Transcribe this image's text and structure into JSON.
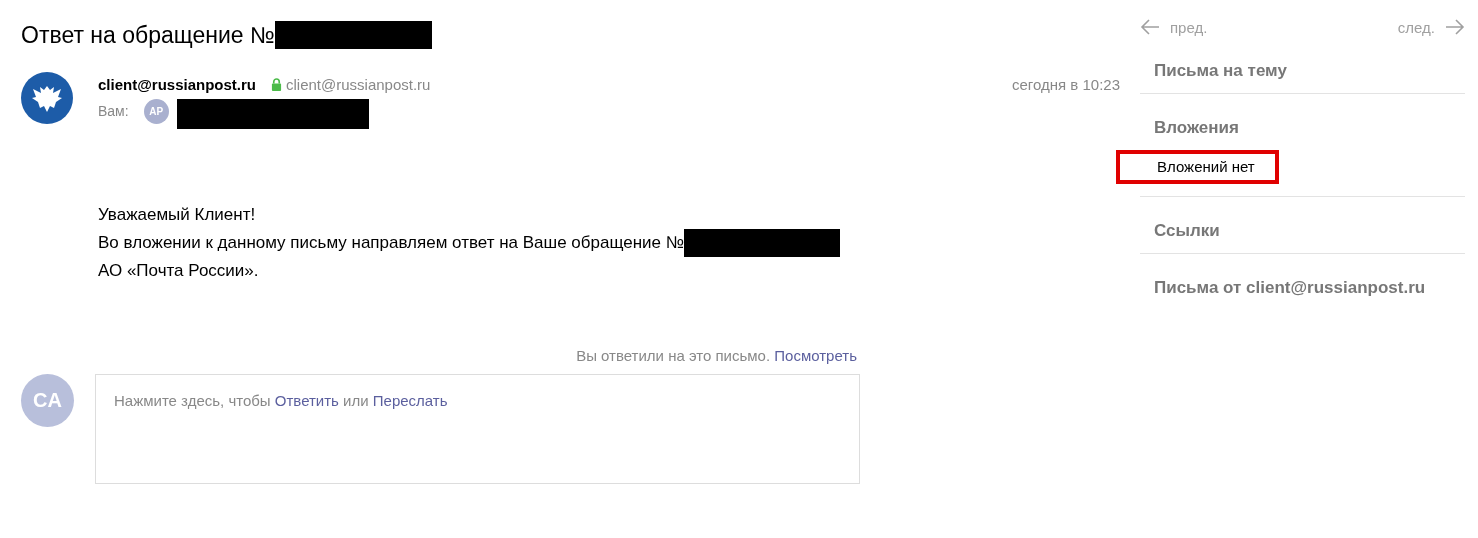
{
  "subject": "Ответ на обращение №",
  "sender": {
    "name": "client@russianpost.ru",
    "address": "client@russianpost.ru",
    "verified": true
  },
  "time": "сегодня в 10:23",
  "recipient": {
    "label": "Вам:",
    "initials": "AP"
  },
  "body": [
    "Уважаемый Клиент!",
    "Во вложении к данному письму направляем ответ на Ваше обращение №",
    "АО «Почта России»."
  ],
  "reply_note": {
    "text": "Вы ответили на это письмо.",
    "link": "Посмотреть"
  },
  "reply_box": {
    "avatar": "CA",
    "prefix": "Нажмите здесь, чтобы",
    "reply": "Ответить",
    "middle": "или",
    "forward": "Переслать"
  },
  "nav": {
    "prev": "пред.",
    "next": "след."
  },
  "sidebar": [
    {
      "kind": "heading",
      "text": "Письма на тему"
    },
    {
      "kind": "heading",
      "text": "Вложения"
    },
    {
      "kind": "note",
      "text": "Вложений нет",
      "highlighted": true
    },
    {
      "kind": "heading",
      "text": "Ссылки"
    },
    {
      "kind": "heading",
      "text": "Письма от client@russianpost.ru"
    }
  ]
}
